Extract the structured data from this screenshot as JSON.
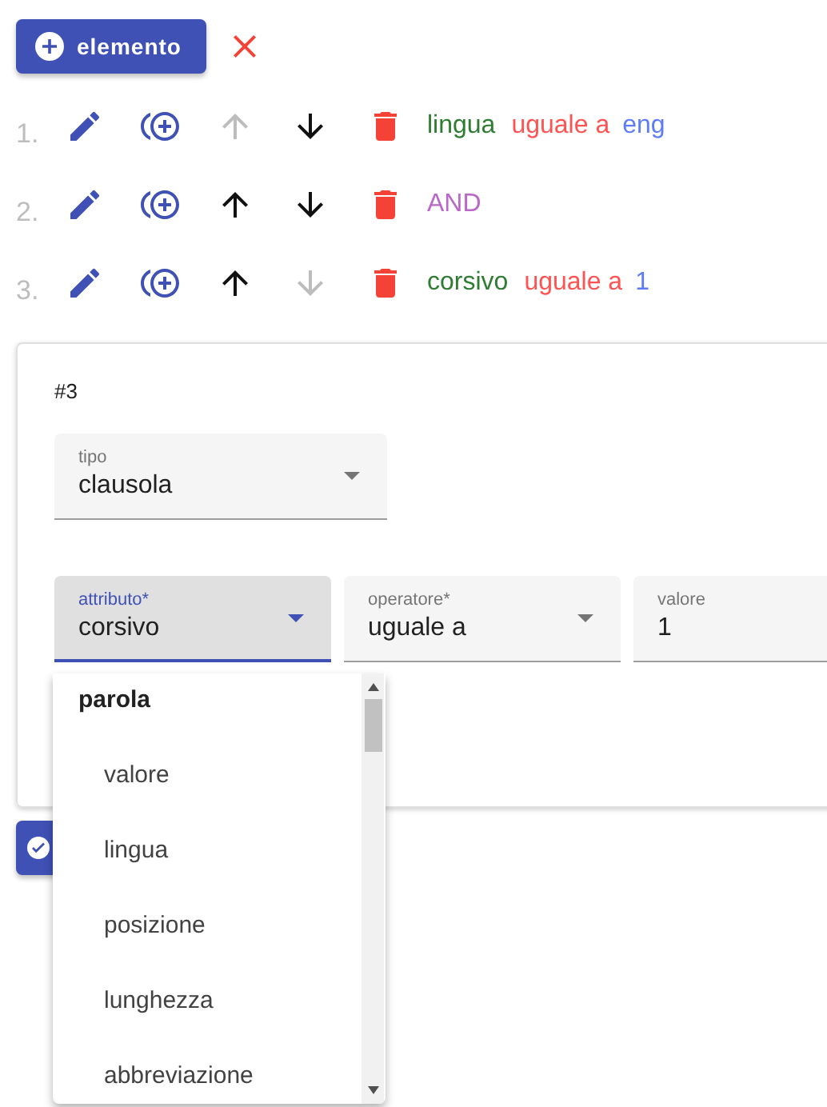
{
  "toolbar": {
    "add_button": "elemento"
  },
  "conditions": [
    {
      "number": "1.",
      "up_disabled": true,
      "down_disabled": false,
      "tokens": [
        {
          "kind": "attribute",
          "text": "lingua"
        },
        {
          "kind": "operator",
          "text": "uguale a"
        },
        {
          "kind": "value",
          "text": "eng"
        }
      ]
    },
    {
      "number": "2.",
      "up_disabled": false,
      "down_disabled": false,
      "tokens": [
        {
          "kind": "connector",
          "text": "AND"
        }
      ]
    },
    {
      "number": "3.",
      "up_disabled": false,
      "down_disabled": true,
      "tokens": [
        {
          "kind": "attribute",
          "text": "corsivo"
        },
        {
          "kind": "operator",
          "text": "uguale a"
        },
        {
          "kind": "value",
          "text": "1"
        }
      ]
    }
  ],
  "editor": {
    "title": "#3",
    "type_field": {
      "label": "tipo",
      "value": "clausola",
      "focused": false
    },
    "fields": [
      {
        "label": "attributo*",
        "value": "corsivo",
        "focused": true,
        "kind": "select"
      },
      {
        "label": "operatore*",
        "value": "uguale a",
        "focused": false,
        "kind": "select"
      },
      {
        "label": "valore",
        "value": "1",
        "focused": false,
        "kind": "text"
      }
    ]
  },
  "dropdown": {
    "items": [
      {
        "kind": "group",
        "text": "parola"
      },
      {
        "kind": "option",
        "text": "valore"
      },
      {
        "kind": "option",
        "text": "lingua"
      },
      {
        "kind": "option",
        "text": "posizione"
      },
      {
        "kind": "option",
        "text": "lunghezza"
      },
      {
        "kind": "option",
        "text": "abbreviazione"
      }
    ]
  }
}
